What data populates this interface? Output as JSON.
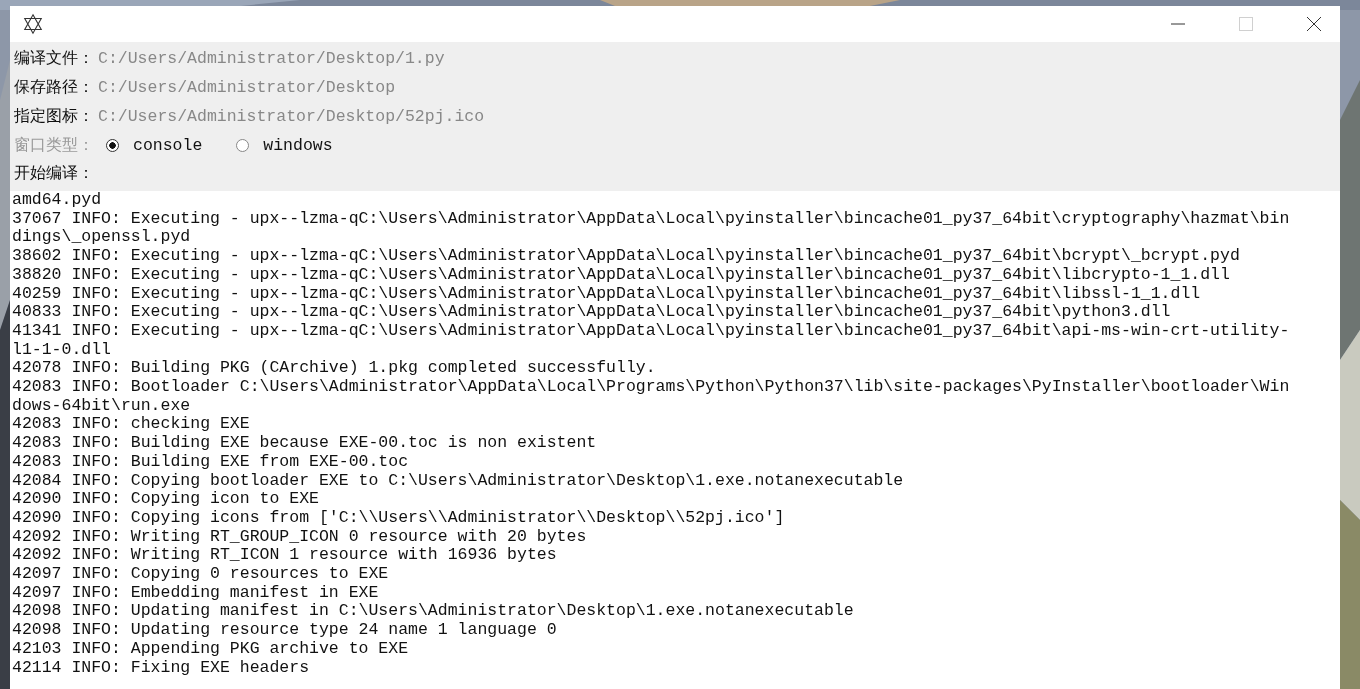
{
  "title_bar": {
    "maximize_enabled": false
  },
  "fields": [
    {
      "label": "编译文件：",
      "value": "C:/Users/Administrator/Desktop/1.py"
    },
    {
      "label": "保存路径：",
      "value": "C:/Users/Administrator/Desktop"
    },
    {
      "label": "指定图标：",
      "value": "C:/Users/Administrator/Desktop/52pj.ico"
    }
  ],
  "window_type": {
    "label": "窗口类型：",
    "disabled": true,
    "options": [
      {
        "label": "console",
        "selected": true
      },
      {
        "label": "windows",
        "selected": false
      }
    ]
  },
  "compile": {
    "label": "开始编译："
  },
  "log": [
    "amd64.pyd",
    "37067 INFO: Executing - upx--lzma-qC:\\Users\\Administrator\\AppData\\Local\\pyinstaller\\bincache01_py37_64bit\\cryptography\\hazmat\\bin",
    "dings\\_openssl.pyd",
    "38602 INFO: Executing - upx--lzma-qC:\\Users\\Administrator\\AppData\\Local\\pyinstaller\\bincache01_py37_64bit\\bcrypt\\_bcrypt.pyd",
    "38820 INFO: Executing - upx--lzma-qC:\\Users\\Administrator\\AppData\\Local\\pyinstaller\\bincache01_py37_64bit\\libcrypto-1_1.dll",
    "40259 INFO: Executing - upx--lzma-qC:\\Users\\Administrator\\AppData\\Local\\pyinstaller\\bincache01_py37_64bit\\libssl-1_1.dll",
    "40833 INFO: Executing - upx--lzma-qC:\\Users\\Administrator\\AppData\\Local\\pyinstaller\\bincache01_py37_64bit\\python3.dll",
    "41341 INFO: Executing - upx--lzma-qC:\\Users\\Administrator\\AppData\\Local\\pyinstaller\\bincache01_py37_64bit\\api-ms-win-crt-utility-",
    "l1-1-0.dll",
    "42078 INFO: Building PKG (CArchive) 1.pkg completed successfully.",
    "42083 INFO: Bootloader C:\\Users\\Administrator\\AppData\\Local\\Programs\\Python\\Python37\\lib\\site-packages\\PyInstaller\\bootloader\\Win",
    "dows-64bit\\run.exe",
    "42083 INFO: checking EXE",
    "42083 INFO: Building EXE because EXE-00.toc is non existent",
    "42083 INFO: Building EXE from EXE-00.toc",
    "42084 INFO: Copying bootloader EXE to C:\\Users\\Administrator\\Desktop\\1.exe.notanexecutable",
    "42090 INFO: Copying icon to EXE",
    "42090 INFO: Copying icons from ['C:\\\\Users\\\\Administrator\\\\Desktop\\\\52pj.ico']",
    "42092 INFO: Writing RT_GROUP_ICON 0 resource with 20 bytes",
    "42092 INFO: Writing RT_ICON 1 resource with 16936 bytes",
    "42097 INFO: Copying 0 resources to EXE",
    "42097 INFO: Embedding manifest in EXE",
    "42098 INFO: Updating manifest in C:\\Users\\Administrator\\Desktop\\1.exe.notanexecutable",
    "42098 INFO: Updating resource type 24 name 1 language 0",
    "42103 INFO: Appending PKG archive to EXE",
    "42114 INFO: Fixing EXE headers"
  ]
}
